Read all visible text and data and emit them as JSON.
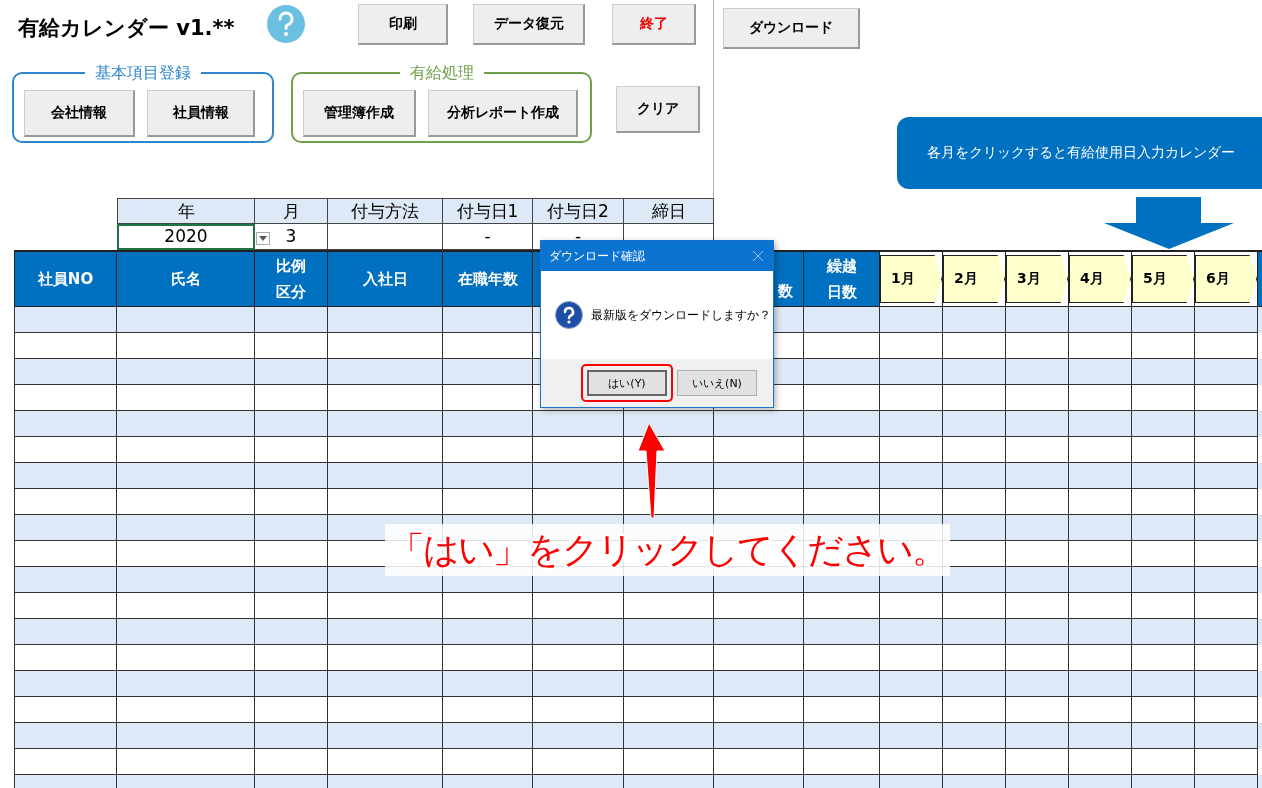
{
  "title": "有給カレンダー v1.**",
  "toolbar": [
    {
      "label": "印刷",
      "kind": "normal"
    },
    {
      "label": "データ復元",
      "kind": "normal"
    },
    {
      "label": "終了",
      "kind": "danger"
    }
  ],
  "groups": [
    {
      "label": "基本項目登録",
      "color": "#2e86d0",
      "buttons": [
        "会社情報",
        "社員情報"
      ]
    },
    {
      "label": "有給処理",
      "color": "#70a04a",
      "buttons": [
        "管理簿作成",
        "分析レポート作成"
      ]
    }
  ],
  "clear_button": "クリア",
  "download_button": "ダウンロード",
  "banner": "各月をクリックすると有給使用日入力カレンダー",
  "settings": [
    {
      "header": "年",
      "value": "2020",
      "selected": true
    },
    {
      "header": "月",
      "value": "3",
      "selected": false
    },
    {
      "header": "付与方法",
      "selected": false
    },
    {
      "header": "付与日1",
      "value": "-",
      "selected": false
    },
    {
      "header": "付与日2",
      "value": "-",
      "selected": false
    },
    {
      "header": "締日",
      "selected": false
    }
  ],
  "columns": [
    {
      "kind": "full",
      "lines": [
        "社員NO"
      ]
    },
    {
      "kind": "full",
      "lines": [
        "氏名"
      ]
    },
    {
      "kind": "full",
      "lines": [
        "比例",
        "区分"
      ]
    },
    {
      "kind": "full",
      "lines": [
        "入社日"
      ]
    },
    {
      "kind": "full",
      "lines": [
        "在職年数"
      ]
    },
    {
      "kind": "hidden"
    },
    {
      "kind": "hidden"
    },
    {
      "kind": "partial",
      "lines": [
        "数"
      ]
    },
    {
      "kind": "full",
      "lines": [
        "繰越",
        "日数"
      ]
    }
  ],
  "months": [
    "1月",
    "2月",
    "3月",
    "4月",
    "5月",
    "6月"
  ],
  "dialog": {
    "title": "ダウンロード確認",
    "message": "最新版をダウンロードしますか？",
    "buttons": [
      {
        "label": "はい(Y)",
        "selected": true
      },
      {
        "label": "いいえ(N)",
        "selected": false
      }
    ]
  },
  "callout": "「はい」をクリックしてください。"
}
